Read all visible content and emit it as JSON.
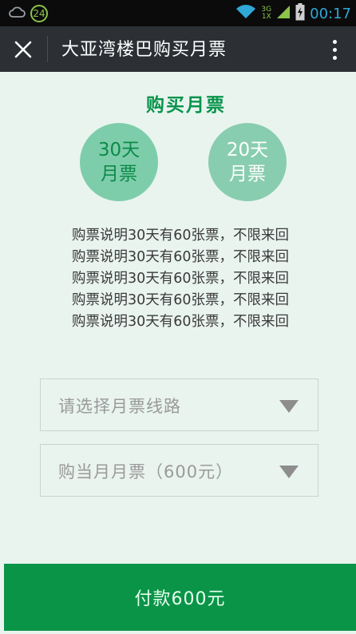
{
  "status_bar": {
    "time": "00:17",
    "notification_count": "24",
    "network_top": "3G",
    "network_bottom": "1X"
  },
  "header": {
    "title": "大亚湾楼巴购买月票"
  },
  "main": {
    "section_title": "购买月票",
    "passes": [
      {
        "line1": "30天",
        "line2": "月票"
      },
      {
        "line1": "20天",
        "line2": "月票"
      }
    ],
    "description_lines": [
      "购票说明30天有60张票，不限来回",
      "购票说明30天有60张票，不限来回",
      "购票说明30天有60张票，不限来回",
      "购票说明30天有60张票，不限来回",
      "购票说明30天有60张票，不限来回"
    ],
    "route_select": "请选择月票线路",
    "ticket_select": "购当月月票（600元）"
  },
  "footer": {
    "pay_button": "付款600元"
  },
  "colors": {
    "accent": "#08944c",
    "page_bg": "#e9f4ef",
    "header_bg": "#2c3035",
    "pass_bg": "#7ecdaa"
  }
}
